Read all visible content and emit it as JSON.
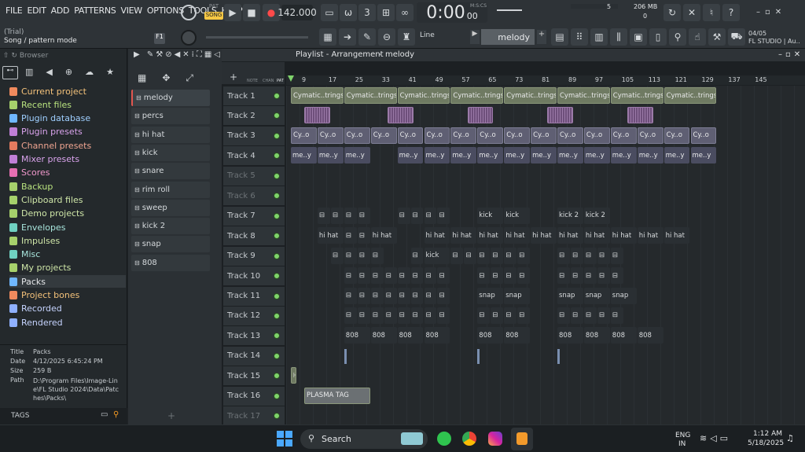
{
  "menu": [
    "FILE",
    "EDIT",
    "ADD",
    "PATTERNS",
    "VIEW",
    "OPTIONS",
    "TOOLS",
    "HELP"
  ],
  "project": {
    "trial": "(Trial)",
    "mode": "Song / pattern mode"
  },
  "transport": {
    "pat_label": "PAT",
    "song_label": "SONG",
    "tempo": "142.000",
    "time": "0:00",
    "time_small": "00",
    "time_label": "M:S:CS",
    "cpu_value": "5",
    "memory": "206 MB",
    "voices": "0"
  },
  "toolbar2": {
    "snap": "Line",
    "pattern": "melody",
    "version": "04/05",
    "studio": "FL STUDIO | Au.."
  },
  "browser": {
    "title": "Browser",
    "items": [
      "Current project",
      "Recent files",
      "Plugin database",
      "Plugin presets",
      "Channel presets",
      "Mixer presets",
      "Scores",
      "Backup",
      "Clipboard files",
      "Demo projects",
      "Envelopes",
      "Impulses",
      "Misc",
      "My projects",
      "Packs",
      "Project bones",
      "Recorded",
      "Rendered"
    ],
    "info_labels": [
      "Title",
      "Date",
      "Size",
      "Path"
    ],
    "info_values": [
      "Packs",
      "4/12/2025 6:45:24 PM",
      "259 B",
      "D:\\Program Files\\Image-Line\\FL Studio 2024\\Data\\Patches\\Packs\\"
    ],
    "tags": "TAGS"
  },
  "channels": [
    "melody",
    "percs",
    "hi hat",
    "kick",
    "snare",
    "rim roll",
    "sweep",
    "kick 2",
    "snap",
    "808"
  ],
  "playlist": {
    "title": "Playlist - Arrangement",
    "pattern": "melody",
    "header_labels": [
      "NOTE",
      "CHAN",
      "PAT"
    ],
    "ruler": [
      "9",
      "17",
      "25",
      "33",
      "41",
      "49",
      "57",
      "65",
      "73",
      "81",
      "89",
      "97",
      "105",
      "113",
      "121",
      "129",
      "137",
      "145"
    ],
    "tracks": [
      "Track 1",
      "Track 2",
      "Track 3",
      "Track 4",
      "Track 5",
      "Track 6",
      "Track 7",
      "Track 8",
      "Track 9",
      "Track 10",
      "Track 11",
      "Track 12",
      "Track 13",
      "Track 14",
      "Track 15",
      "Track 16",
      "Track 17"
    ],
    "clip_names": {
      "aud": "Cymatic..trings",
      "pat": "Cy..o",
      "me": "me..y",
      "hihat": "hi hat",
      "kick": "kick",
      "kick2": "kick 2",
      "snap": "snap",
      "b808": "808",
      "plasma": "PLASMA TAG"
    }
  },
  "taskbar": {
    "search": "Search",
    "lang1": "ENG",
    "lang2": "IN",
    "time": "1:12 AM",
    "date": "5/18/2025"
  },
  "colors": {
    "accent": "#7fd36b",
    "song": "#f6c744"
  }
}
